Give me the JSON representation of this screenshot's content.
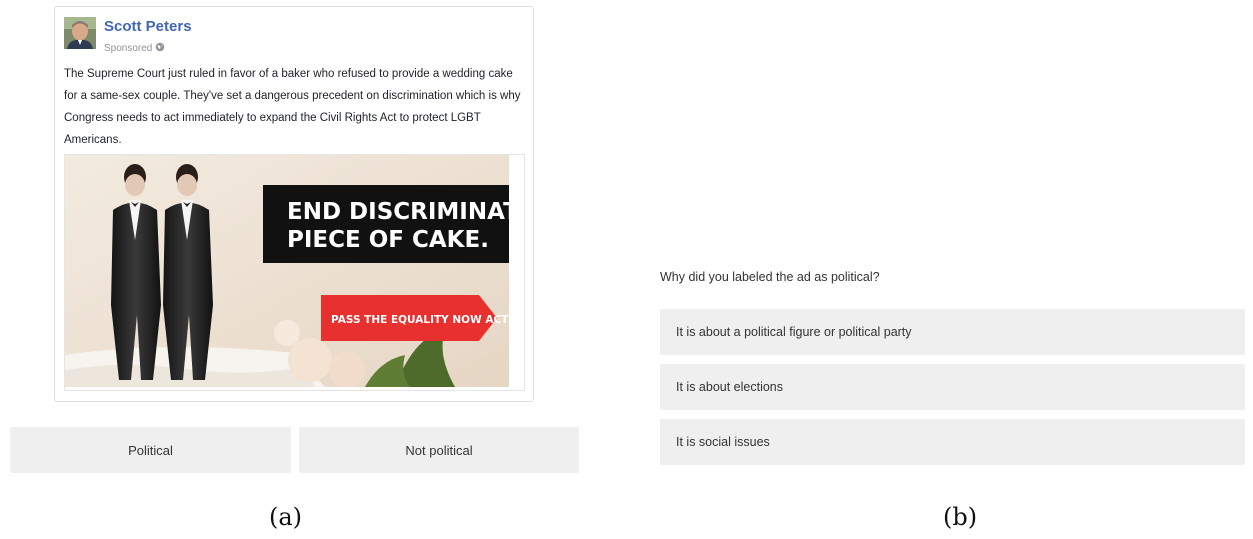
{
  "panel_a": {
    "ad": {
      "advertiser": "Scott Peters",
      "sponsored_label": "Sponsored",
      "body_text": "The Supreme Court just ruled in favor of a baker who refused to provide a wedding cake for a same-sex couple. They've set a dangerous precedent on discrimination which is why Congress needs to act immediately to expand the Civil Rights Act to protect LGBT Americans.",
      "image": {
        "headline_line1": "END DISCRIMINATION?",
        "headline_line2": "PIECE OF CAKE.",
        "cta": "PASS THE EQUALITY NOW ACT"
      }
    },
    "buttons": {
      "political": "Political",
      "not_political": "Not political"
    },
    "caption": "(a)"
  },
  "panel_b": {
    "question": "Why did you labeled the ad as political?",
    "options": [
      "It is about a political figure or political party",
      "It is about elections",
      "It is social issues"
    ],
    "caption": "(b)"
  },
  "colors": {
    "advertiser_link": "#4267b2",
    "button_bg": "#efefef",
    "cta_red": "#e8312f",
    "headline_box": "#111111",
    "image_bg": "#efe3d5"
  },
  "icons": {
    "sponsored": "globe-icon"
  }
}
